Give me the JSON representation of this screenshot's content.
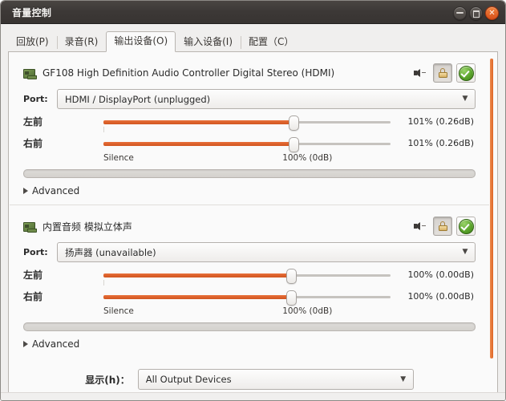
{
  "window": {
    "title": "音量控制",
    "buttons": {
      "minimize": "minimize",
      "maximize": "maximize",
      "close": "close"
    }
  },
  "tabs": [
    {
      "label": "回放(P)",
      "active": false
    },
    {
      "label": "录音(R)",
      "active": false
    },
    {
      "label": "输出设备(O)",
      "active": true
    },
    {
      "label": "输入设备(I)",
      "active": false
    },
    {
      "label": "配置（C）",
      "active": false
    }
  ],
  "devices": [
    {
      "name": "GF108 High Definition Audio Controller Digital Stereo (HDMI)",
      "icon": "sound-card-icon",
      "mute_icon": "speaker-icon",
      "lock_button": "lock-icon",
      "default_button": "green-check-icon",
      "port_label": "Port:",
      "port_value": "HDMI / DisplayPort (unplugged)",
      "channels": [
        {
          "label": "左前",
          "value": "101% (0.26dB)",
          "percent": 101
        },
        {
          "label": "右前",
          "value": "101% (0.26dB)",
          "percent": 101
        }
      ],
      "scale_min": "Silence",
      "scale_base": "100% (0dB)",
      "advanced_label": "Advanced"
    },
    {
      "name": "内置音频 模拟立体声",
      "icon": "sound-card-icon",
      "mute_icon": "speaker-icon",
      "lock_button": "lock-icon",
      "default_button": "green-check-icon",
      "port_label": "Port:",
      "port_value": "扬声器 (unavailable)",
      "channels": [
        {
          "label": "左前",
          "value": "100% (0.00dB)",
          "percent": 100
        },
        {
          "label": "右前",
          "value": "100% (0.00dB)",
          "percent": 100
        }
      ],
      "scale_min": "Silence",
      "scale_base": "100% (0dB)",
      "advanced_label": "Advanced"
    }
  ],
  "show_filter": {
    "label": "显示(h)：",
    "value": "All Output Devices",
    "arrow": "▼"
  },
  "colors": {
    "accent_orange": "#d1551f",
    "titlebar": "#3c3836",
    "close_button": "#d8501a",
    "check_green": "#5ba52c",
    "pane_background": "#fafafa"
  }
}
